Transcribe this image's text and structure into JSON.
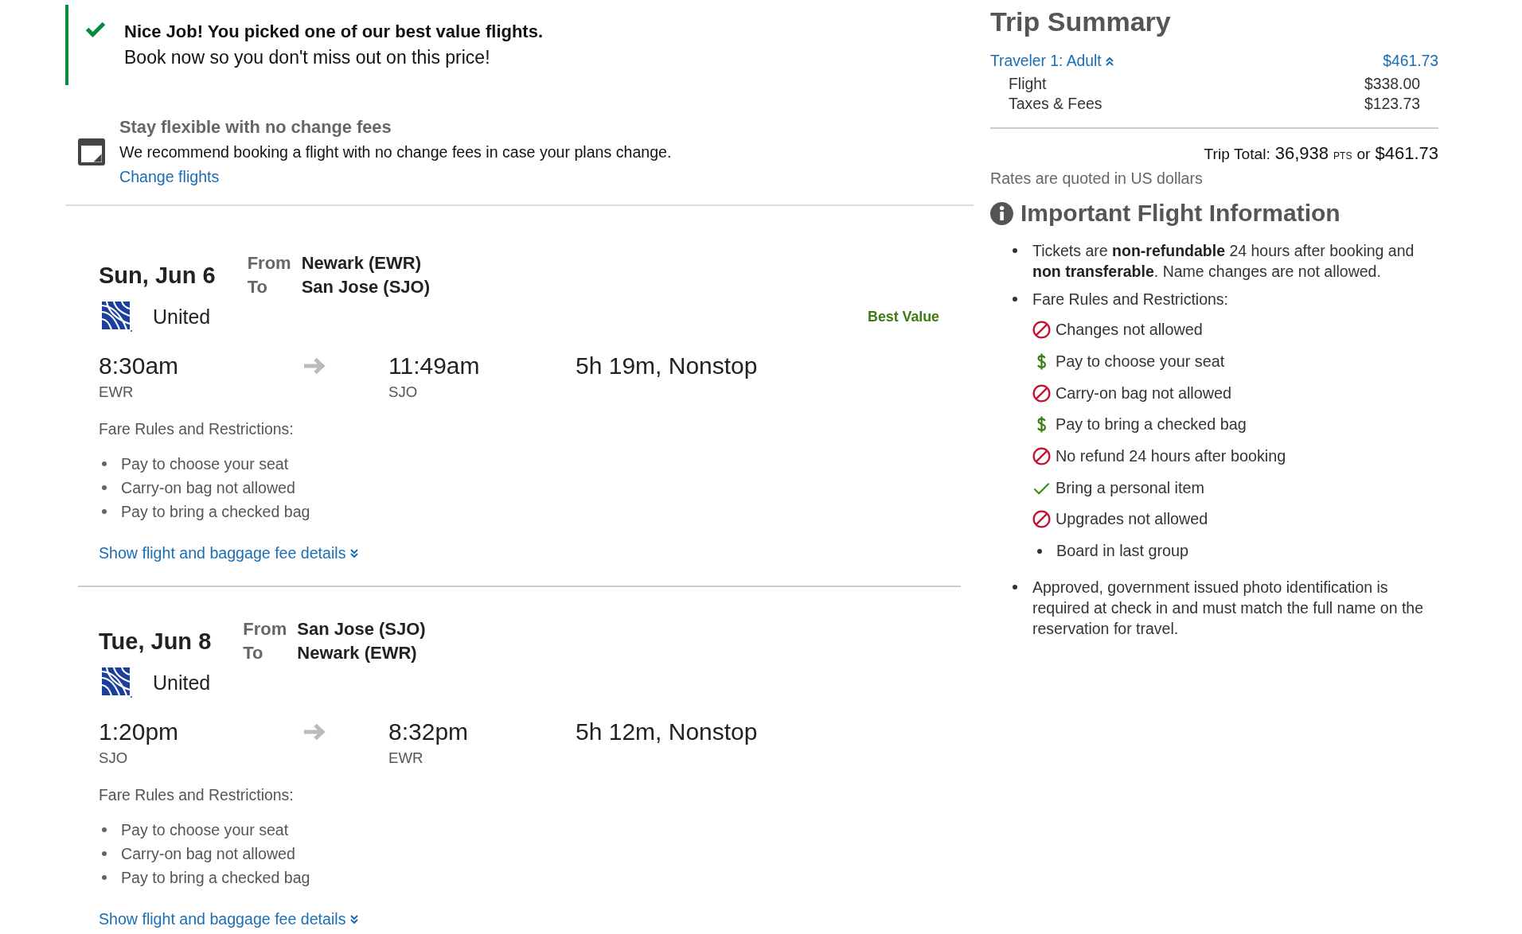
{
  "banner": {
    "title": "Nice Job! You picked one of our best value flights.",
    "message": "Book now so you don't miss out on this price!"
  },
  "flexibility_notice": {
    "title": "Stay flexible with no change fees",
    "message": "We recommend booking a flight with no change fees in case your plans change.",
    "link": "Change flights"
  },
  "flights": [
    {
      "date": "Sun, Jun 6",
      "from_label": "From",
      "from": "Newark (EWR)",
      "to_label": "To",
      "to": "San Jose (SJO)",
      "airline": "United",
      "badge": "Best Value",
      "departure_time": "8:30am",
      "departure_code": "EWR",
      "arrival_time": "11:49am",
      "arrival_code": "SJO",
      "duration": "5h 19m, Nonstop",
      "fare_rules_title": "Fare Rules and Restrictions:",
      "fare_rules": [
        "Pay to choose your seat",
        "Carry-on bag not allowed",
        "Pay to bring a checked bag"
      ],
      "details_link": "Show flight and baggage fee details",
      "details_expanded": false
    },
    {
      "date": "Tue, Jun 8",
      "from_label": "From",
      "from": "San Jose (SJO)",
      "to_label": "To",
      "to": "Newark (EWR)",
      "airline": "United",
      "departure_time": "1:20pm",
      "departure_code": "SJO",
      "arrival_time": "8:32pm",
      "arrival_code": "EWR",
      "duration": "5h 12m, Nonstop",
      "fare_rules_title": "Fare Rules and Restrictions:",
      "fare_rules": [
        "Pay to choose your seat",
        "Carry-on bag not allowed",
        "Pay to bring a checked bag"
      ],
      "details_link": "Show flight and baggage fee details",
      "details_expanded": false
    }
  ],
  "trip_summary": {
    "title": "Trip Summary",
    "traveler": {
      "label": "Traveler 1: Adult",
      "expanded": true,
      "amount": "$461.73"
    },
    "lines": [
      {
        "label": "Flight",
        "amount": "$338.00"
      },
      {
        "label": "Taxes & Fees",
        "amount": "$123.73"
      }
    ],
    "total": {
      "label": "Trip Total:",
      "points": "36,938",
      "points_unit": "PTS",
      "conjunction": "or",
      "amount": "$461.73"
    },
    "note": "Rates are quoted in US dollars"
  },
  "important_info": {
    "title": "Important Flight Information",
    "items": [
      {
        "kind": "text",
        "text": "Tickets are **non-refundable** 24 hours after booking and **non transferable**. Name changes are not allowed."
      },
      {
        "kind": "rules",
        "text": "Fare Rules and Restrictions:",
        "rules": [
          {
            "kind": "not_allowed",
            "text": "Changes not allowed"
          },
          {
            "kind": "fee",
            "text": "Pay to choose your seat"
          },
          {
            "kind": "not_allowed",
            "text": "Carry-on bag not allowed"
          },
          {
            "kind": "fee",
            "text": "Pay to bring a checked bag"
          },
          {
            "kind": "not_allowed",
            "text": "No refund 24 hours after booking"
          },
          {
            "kind": "allowed",
            "text": "Bring a personal item"
          },
          {
            "kind": "not_allowed",
            "text": "Upgrades not allowed"
          },
          {
            "kind": "plain",
            "text": "Board in last group"
          }
        ]
      },
      {
        "kind": "text",
        "text": "Approved, government issued photo identification is required at check in and must match the full name on the reservation for travel."
      }
    ]
  }
}
